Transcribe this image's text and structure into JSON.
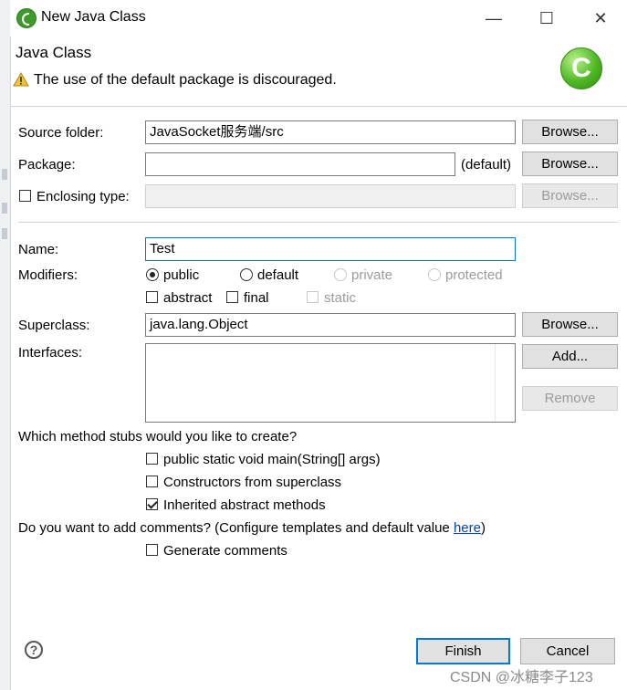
{
  "window": {
    "title": "New Java Class",
    "controls": {
      "minimize": "—",
      "maximize": "☐",
      "close": "✕"
    }
  },
  "header": {
    "title": "Java Class",
    "warning": "The use of the default package is discouraged.",
    "badge_letter": "C"
  },
  "form": {
    "source_folder": {
      "label": "Source folder:",
      "value": "JavaSocket服务端/src",
      "button": "Browse..."
    },
    "package": {
      "label": "Package:",
      "value": "",
      "suffix": "(default)",
      "button": "Browse..."
    },
    "enclosing_type": {
      "label": "Enclosing type:",
      "checked": false,
      "value": "",
      "button": "Browse..."
    },
    "name": {
      "label": "Name:",
      "value": "Test"
    },
    "modifiers": {
      "label": "Modifiers:",
      "access": [
        {
          "label": "public",
          "selected": true,
          "enabled": true
        },
        {
          "label": "default",
          "selected": false,
          "enabled": true
        },
        {
          "label": "private",
          "selected": false,
          "enabled": false
        },
        {
          "label": "protected",
          "selected": false,
          "enabled": false
        }
      ],
      "flags": [
        {
          "label": "abstract",
          "checked": false,
          "enabled": true
        },
        {
          "label": "final",
          "checked": false,
          "enabled": true
        },
        {
          "label": "static",
          "checked": false,
          "enabled": false
        }
      ]
    },
    "superclass": {
      "label": "Superclass:",
      "value": "java.lang.Object",
      "button": "Browse..."
    },
    "interfaces": {
      "label": "Interfaces:",
      "add_button": "Add...",
      "remove_button": "Remove"
    },
    "stubs": {
      "question": "Which method stubs would you like to create?",
      "options": [
        {
          "label": "public static void main(String[] args)",
          "checked": false
        },
        {
          "label": "Constructors from superclass",
          "checked": false
        },
        {
          "label": "Inherited abstract methods",
          "checked": true
        }
      ]
    },
    "comments": {
      "question": "Do you want to add comments? (Configure templates and default value",
      "link": "here",
      "close_paren": ")",
      "option": {
        "label": "Generate comments",
        "checked": false
      }
    }
  },
  "footer": {
    "help": "?",
    "finish": "Finish",
    "cancel": "Cancel"
  },
  "watermark": "CSDN @冰糖李子123"
}
